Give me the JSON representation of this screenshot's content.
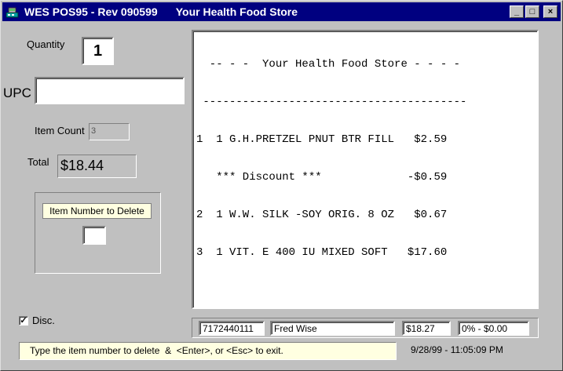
{
  "window": {
    "title": "WES POS95 - Rev 090599      Your Health Food Store",
    "minimize_glyph": "_",
    "maximize_glyph": "□",
    "close_glyph": "×",
    "icon": "register-icon"
  },
  "form": {
    "quantity_label": "Quantity",
    "quantity_value": "1",
    "upc_label": "UPC",
    "upc_value": "",
    "item_count_label": "Item Count",
    "item_count_value": "3",
    "total_label": "Total",
    "total_value": "$18.44",
    "delete_label": "Item Number to Delete",
    "delete_value": "",
    "disc_label": "Disc.",
    "disc_checked_glyph": "✓"
  },
  "receipt": {
    "lines": [
      "  -- - -  Your Health Food Store - - - -",
      " ----------------------------------------",
      "1  1 G.H.PRETZEL PNUT BTR FILL   $2.59",
      "   *** Discount ***             -$0.59",
      "2  1 W.W. SILK -SOY ORIG. 8 OZ   $0.67",
      "3  1 VIT. E 400 IU MIXED SOFT   $17.60"
    ]
  },
  "status": {
    "phone": "7172440111",
    "name": "Fred Wise",
    "amount": "$18.27",
    "discount": "0% - $0.00",
    "message": "Type the item number to delete  &  <Enter>, or <Esc> to exit.",
    "datetime": "9/28/99 - 11:05:09 PM"
  }
}
